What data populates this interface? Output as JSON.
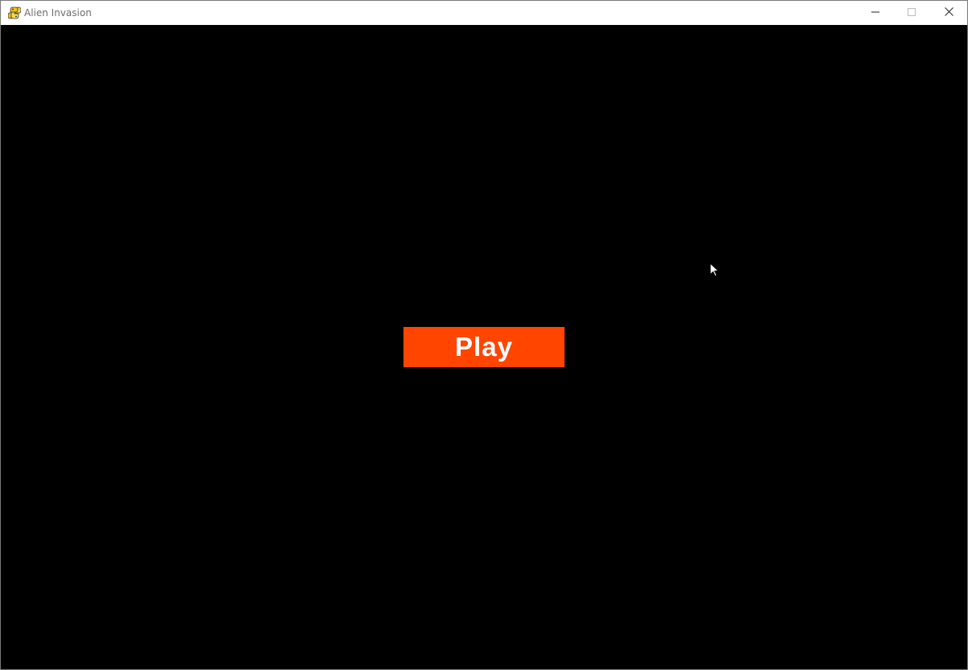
{
  "window": {
    "title": "Alien Invasion",
    "app_icon": "pygame-snake-icon",
    "controls": {
      "minimize_icon": "minimize-icon",
      "maximize_icon": "maximize-icon",
      "close_icon": "close-icon"
    }
  },
  "game": {
    "background_color": "#000000",
    "play_button": {
      "label": "Play",
      "color": "#ff4500",
      "text_color": "#ffffff"
    },
    "cursor_icon": "arrow-cursor-icon"
  }
}
